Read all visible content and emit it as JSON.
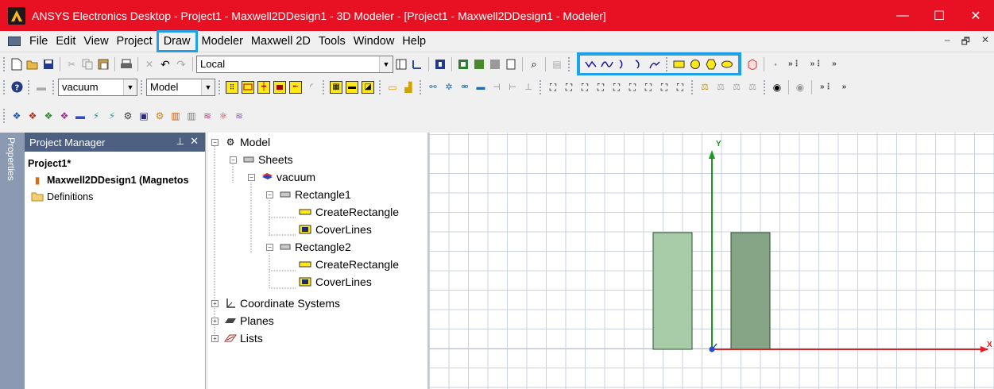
{
  "window": {
    "title": "ANSYS Electronics Desktop - Project1 - Maxwell2DDesign1 - 3D Modeler - [Project1 - Maxwell2DDesign1 - Modeler]",
    "min": "—",
    "max": "☐",
    "close": "✕"
  },
  "menu": {
    "items": [
      "File",
      "Edit",
      "View",
      "Project",
      "Draw",
      "Modeler",
      "Maxwell 2D",
      "Tools",
      "Window",
      "Help"
    ],
    "highlighted": "Draw",
    "mdi_min": "–",
    "mdi_restore": "🗗",
    "mdi_close": "✕"
  },
  "toolbar1": {
    "coord_system": "Local"
  },
  "toolbar2": {
    "material": "vacuum",
    "mode": "Model"
  },
  "project_manager": {
    "side_tab": "Properties",
    "title": "Project Manager",
    "pin": "ᵖ",
    "close": "✕",
    "project": "Project1*",
    "design": "Maxwell2DDesign1 (Magnetos",
    "definitions": "Definitions"
  },
  "model_tree": {
    "model": "Model",
    "sheets": "Sheets",
    "material": "vacuum",
    "rect1": "Rectangle1",
    "rect1_create": "CreateRectangle",
    "rect1_cover": "CoverLines",
    "rect2": "Rectangle2",
    "rect2_create": "CreateRectangle",
    "rect2_cover": "CoverLines",
    "coordinate_systems": "Coordinate Systems",
    "planes": "Planes",
    "lists": "Lists"
  },
  "modeler": {
    "axis_y": "Y",
    "axis_x": "X"
  },
  "colors": {
    "titlebar": "#e81123",
    "highlight": "#1ea1e8",
    "rect_light": "#a8cba8",
    "rect_dark": "#86a586"
  }
}
